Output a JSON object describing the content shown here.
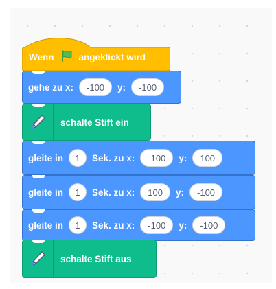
{
  "script": {
    "hat": {
      "prefix": "Wenn",
      "flag_icon": "green-flag-icon",
      "suffix": "angeklickt wird"
    },
    "goto": {
      "label": "gehe zu x:",
      "x": "-100",
      "ylabel": "y:",
      "y": "-100"
    },
    "pen_down": {
      "icon": "pen-icon",
      "label": "schalte Stift ein"
    },
    "glides": [
      {
        "label": "gleite in",
        "secs": "1",
        "to_x": "Sek. zu x:",
        "x": "-100",
        "ylabel": "y:",
        "y": "100"
      },
      {
        "label": "gleite in",
        "secs": "1",
        "to_x": "Sek. zu x:",
        "x": "100",
        "ylabel": "y:",
        "y": "-100"
      },
      {
        "label": "gleite in",
        "secs": "1",
        "to_x": "Sek. zu x:",
        "x": "-100",
        "ylabel": "y:",
        "y": "-100"
      }
    ],
    "pen_up": {
      "icon": "pen-icon",
      "label": "schalte Stift aus"
    }
  },
  "colors": {
    "events": "#ffbf00",
    "motion": "#4c97ff",
    "pen": "#0fbd8c",
    "flag": "#4cbf56"
  }
}
